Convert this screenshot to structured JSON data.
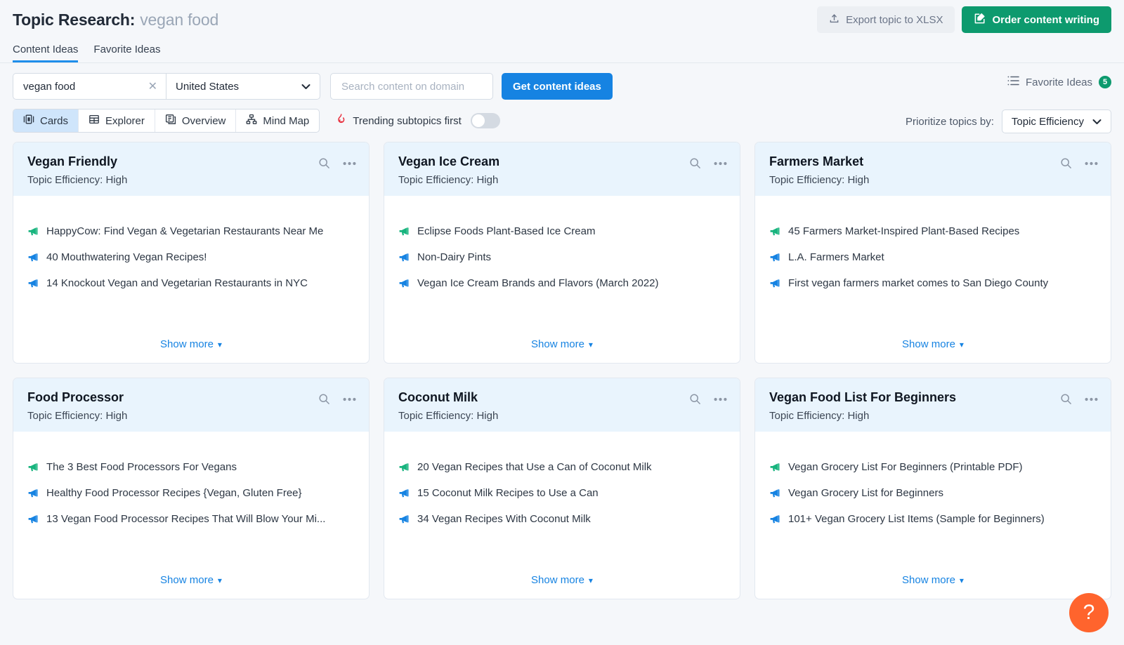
{
  "header": {
    "title_prefix": "Topic Research:",
    "keyword": "vegan food",
    "export_label": "Export topic to XLSX",
    "order_label": "Order content writing",
    "export_icon": "upload-icon",
    "order_icon": "edit-square-icon"
  },
  "tabs": [
    {
      "label": "Content Ideas",
      "active": true
    },
    {
      "label": "Favorite Ideas",
      "active": false
    }
  ],
  "filters": {
    "keyword_value": "vegan food",
    "keyword_clear": "✕",
    "country_value": "United States",
    "domain_placeholder": "Search content on domain",
    "domain_value": "",
    "submit_label": "Get content ideas",
    "favorites_label": "Favorite Ideas",
    "favorites_count": "5"
  },
  "views": {
    "items": [
      {
        "label": "Cards",
        "icon": "cards-view-icon",
        "active": true
      },
      {
        "label": "Explorer",
        "icon": "table-view-icon",
        "active": false
      },
      {
        "label": "Overview",
        "icon": "overview-view-icon",
        "active": false
      },
      {
        "label": "Mind Map",
        "icon": "mindmap-view-icon",
        "active": false
      }
    ],
    "trending_label": "Trending subtopics first",
    "trending_icon": "flame-icon",
    "trending_on": false,
    "prioritize_label": "Prioritize topics by:",
    "prioritize_value": "Topic Efficiency"
  },
  "colors": {
    "accent_blue": "#1683e2",
    "accent_green": "#0d9a6e",
    "card_head_bg": "#e9f4fd",
    "flame_red": "#e8313f",
    "help_orange": "#ff642d",
    "mega_green": "#18b47e",
    "mega_blue": "#1683e2"
  },
  "cards": [
    {
      "title": "Vegan Friendly",
      "efficiency": "Topic Efficiency: High",
      "show_more": "Show more",
      "ideas": [
        {
          "text": "HappyCow: Find Vegan & Vegetarian Restaurants Near Me",
          "color": "green"
        },
        {
          "text": "40 Mouthwatering Vegan Recipes!",
          "color": "blue"
        },
        {
          "text": "14 Knockout Vegan and Vegetarian Restaurants in NYC",
          "color": "blue"
        }
      ]
    },
    {
      "title": "Vegan Ice Cream",
      "efficiency": "Topic Efficiency: High",
      "show_more": "Show more",
      "ideas": [
        {
          "text": "Eclipse Foods Plant-Based Ice Cream",
          "color": "green"
        },
        {
          "text": "Non-Dairy Pints",
          "color": "blue"
        },
        {
          "text": "Vegan Ice Cream Brands and Flavors (March 2022)",
          "color": "blue"
        }
      ]
    },
    {
      "title": "Farmers Market",
      "efficiency": "Topic Efficiency: High",
      "show_more": "Show more",
      "ideas": [
        {
          "text": "45 Farmers Market-Inspired Plant-Based Recipes",
          "color": "green"
        },
        {
          "text": "L.A. Farmers Market",
          "color": "blue"
        },
        {
          "text": "First vegan farmers market comes to San Diego County",
          "color": "blue"
        }
      ]
    },
    {
      "title": "Food Processor",
      "efficiency": "Topic Efficiency: High",
      "show_more": "Show more",
      "ideas": [
        {
          "text": "The 3 Best Food Processors For Vegans",
          "color": "green"
        },
        {
          "text": "Healthy Food Processor Recipes {Vegan, Gluten Free}",
          "color": "blue"
        },
        {
          "text": "13 Vegan Food Processor Recipes That Will Blow Your Mi...",
          "color": "blue"
        }
      ]
    },
    {
      "title": "Coconut Milk",
      "efficiency": "Topic Efficiency: High",
      "show_more": "Show more",
      "ideas": [
        {
          "text": "20 Vegan Recipes that Use a Can of Coconut Milk",
          "color": "green"
        },
        {
          "text": "15 Coconut Milk Recipes to Use a Can",
          "color": "blue"
        },
        {
          "text": "34 Vegan Recipes With Coconut Milk",
          "color": "blue"
        }
      ]
    },
    {
      "title": "Vegan Food List For Beginners",
      "efficiency": "Topic Efficiency: High",
      "show_more": "Show more",
      "ideas": [
        {
          "text": "Vegan Grocery List For Beginners (Printable PDF)",
          "color": "green"
        },
        {
          "text": "Vegan Grocery List for Beginners",
          "color": "blue"
        },
        {
          "text": "101+ Vegan Grocery List Items (Sample for Beginners)",
          "color": "blue"
        }
      ]
    }
  ],
  "help": {
    "label": "?"
  }
}
